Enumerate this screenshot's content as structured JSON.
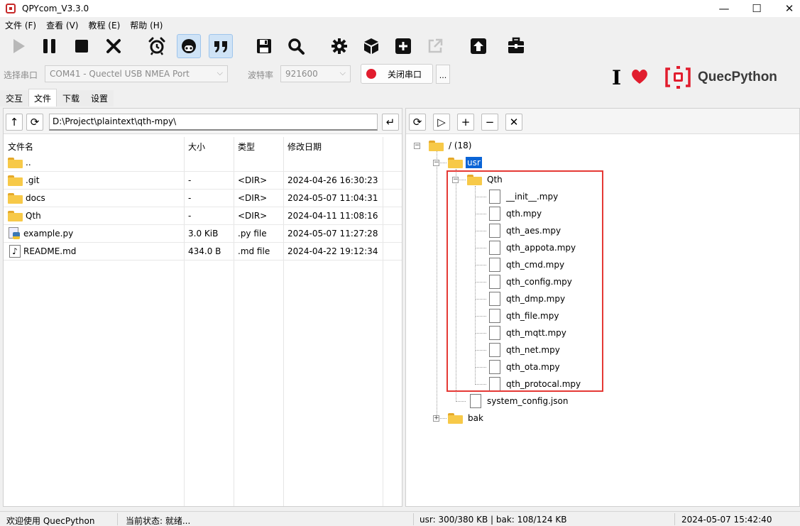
{
  "window": {
    "title": "QPYcom_V3.3.0",
    "min": "—",
    "max": "☐",
    "close": "✕"
  },
  "menu": [
    "文件 (F)",
    "查看 (V)",
    "教程 (E)",
    "帮助 (H)"
  ],
  "toolbar": {
    "icons": [
      "play-icon",
      "pause-icon",
      "stop-icon",
      "close-x-icon",
      "alarm-clock-icon",
      "robot-face-icon",
      "quote-icon",
      "save-disk-icon",
      "search-icon",
      "gear-icon",
      "cube-icon",
      "plus-box-icon",
      "export-icon",
      "upload-icon",
      "toolbox-icon"
    ],
    "active": [
      "robot-face-icon",
      "quote-icon"
    ],
    "disabled": [
      "play-icon",
      "export-icon"
    ]
  },
  "port": {
    "label": "选择串口",
    "value": "COM41 - Quectel USB NMEA Port",
    "baud_label": "波特率",
    "baud_value": "921600",
    "close_button": "关闭串口",
    "more_button": "..."
  },
  "brand": {
    "name": "QuecPython",
    "accent": "#e11d2e"
  },
  "tabs": [
    {
      "label": "交互",
      "selected": false
    },
    {
      "label": "文件",
      "selected": true
    },
    {
      "label": "下载",
      "selected": false
    },
    {
      "label": "设置",
      "selected": false
    }
  ],
  "local": {
    "path": "D:\\Project\\plaintext\\qth-mpy\\",
    "up": "↑",
    "refresh": "⟳",
    "enter": "↵",
    "columns": [
      "文件名",
      "大小",
      "类型",
      "修改日期"
    ],
    "rows": [
      {
        "name": "..",
        "size": "",
        "type": "",
        "date": "",
        "icon": "folder"
      },
      {
        "name": ".git",
        "size": "-",
        "type": "<DIR>",
        "date": "2024-04-26 16:30:23",
        "icon": "folder"
      },
      {
        "name": "docs",
        "size": "-",
        "type": "<DIR>",
        "date": "2024-05-07 11:04:31",
        "icon": "folder"
      },
      {
        "name": "Qth",
        "size": "-",
        "type": "<DIR>",
        "date": "2024-04-11 11:08:16",
        "icon": "folder"
      },
      {
        "name": "example.py",
        "size": "3.0 KiB",
        "type": ".py file",
        "date": "2024-05-07 11:27:28",
        "icon": "python"
      },
      {
        "name": "README.md",
        "size": "434.0 B",
        "type": ".md file",
        "date": "2024-04-22 19:12:34",
        "icon": "music"
      }
    ]
  },
  "device": {
    "buttons": [
      "⟳",
      "▷",
      "+",
      "−",
      "✕"
    ],
    "root": "/ (18)",
    "usr": "usr",
    "qth": "Qth",
    "qth_files": [
      "__init__.mpy",
      "qth.mpy",
      "qth_aes.mpy",
      "qth_appota.mpy",
      "qth_cmd.mpy",
      "qth_config.mpy",
      "qth_dmp.mpy",
      "qth_file.mpy",
      "qth_mqtt.mpy",
      "qth_net.mpy",
      "qth_ota.mpy",
      "qth_protocal.mpy"
    ],
    "usr_file": "system_config.json",
    "bak": "bak",
    "highlight_color": "#e53935"
  },
  "status": {
    "welcome": "欢迎使用 QuecPython",
    "state": "当前状态: 就绪...",
    "storage": "usr: 300/380 KB | bak: 108/124 KB",
    "datetime": "2024-05-07 15:42:40"
  }
}
